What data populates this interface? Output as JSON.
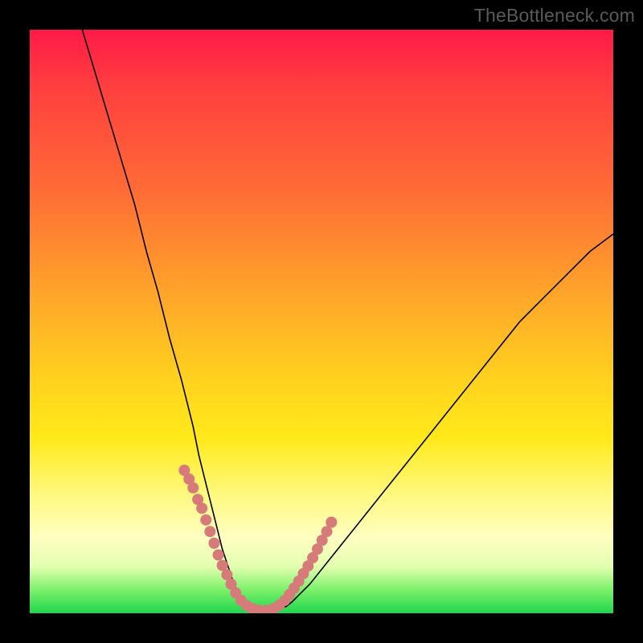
{
  "watermark": "TheBottleneck.com",
  "chart_data": {
    "type": "line",
    "title": "",
    "xlabel": "",
    "ylabel": "",
    "xlim": [
      0,
      100
    ],
    "ylim": [
      0,
      100
    ],
    "grid": false,
    "legend": false,
    "series": [
      {
        "name": "curve",
        "color": "#000000",
        "x": [
          9,
          12,
          15,
          18,
          20,
          22,
          24,
          26,
          28,
          29,
          30,
          31,
          32,
          33,
          34,
          35,
          36,
          37,
          38,
          40,
          42,
          44,
          45,
          48,
          52,
          56,
          60,
          64,
          68,
          72,
          76,
          80,
          84,
          88,
          92,
          96,
          100
        ],
        "y": [
          100,
          90,
          80,
          70,
          62,
          55,
          47,
          40,
          32,
          27,
          23,
          19,
          15,
          11,
          8,
          5,
          3,
          1.5,
          0.7,
          0.3,
          0.4,
          1.2,
          2,
          5,
          10,
          15,
          20,
          25,
          30,
          35,
          40,
          45,
          50,
          54,
          58,
          62,
          65
        ]
      },
      {
        "name": "marker-dots",
        "color": "#d77a7a",
        "type": "scatter",
        "x": [
          26.5,
          27.3,
          28.0,
          28.8,
          29.5,
          30.2,
          30.9,
          31.6,
          32.3,
          33.0,
          33.8,
          34.5,
          35.3,
          36.2,
          37.2,
          38.2,
          39.4,
          40.6,
          41.8,
          42.8,
          43.7,
          44.5,
          45.3,
          46.1,
          46.9,
          47.7,
          48.5,
          49.3,
          50.1,
          50.9,
          51.7
        ],
        "y": [
          24.5,
          23.0,
          21.5,
          19.5,
          18.0,
          16.0,
          14.0,
          12.0,
          10.0,
          8.2,
          6.6,
          5.0,
          3.5,
          2.2,
          1.3,
          0.8,
          0.5,
          0.5,
          0.8,
          1.4,
          2.2,
          3.2,
          4.3,
          5.5,
          6.8,
          8.1,
          9.5,
          11.0,
          12.5,
          14.0,
          15.6
        ]
      }
    ],
    "background_gradient_stops": [
      {
        "pos": 0.0,
        "color": "#ff1a48"
      },
      {
        "pos": 0.1,
        "color": "#ff3f3f"
      },
      {
        "pos": 0.27,
        "color": "#ff6a36"
      },
      {
        "pos": 0.45,
        "color": "#ffa42a"
      },
      {
        "pos": 0.6,
        "color": "#ffd21e"
      },
      {
        "pos": 0.7,
        "color": "#ffe91a"
      },
      {
        "pos": 0.8,
        "color": "#fff982"
      },
      {
        "pos": 0.87,
        "color": "#fffec0"
      },
      {
        "pos": 0.92,
        "color": "#e3ffb0"
      },
      {
        "pos": 0.96,
        "color": "#7cf06a"
      },
      {
        "pos": 1.0,
        "color": "#1fd64e"
      }
    ]
  }
}
